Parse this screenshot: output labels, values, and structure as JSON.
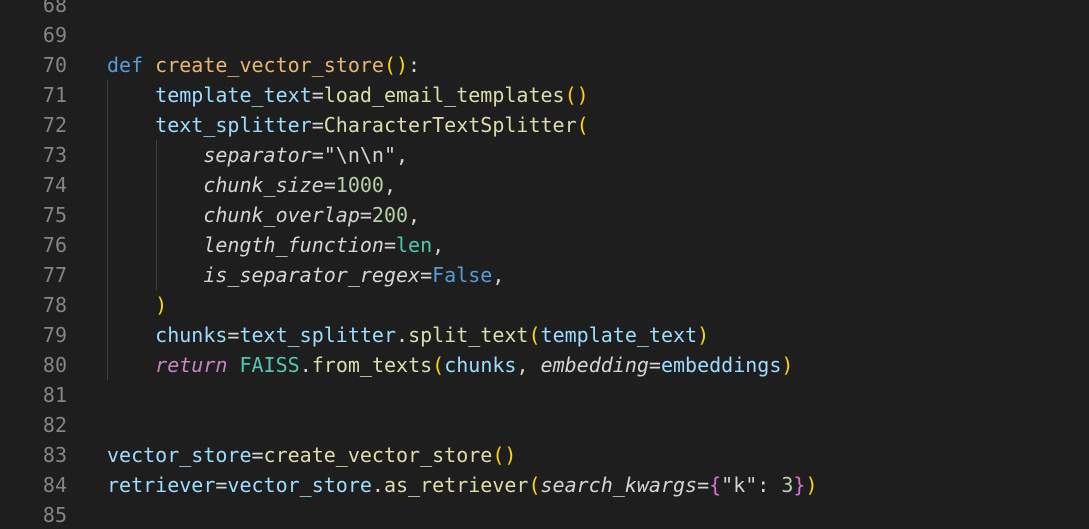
{
  "editor": {
    "language": "python",
    "colors": {
      "background": "#1e1e1e",
      "line_number": "#858585",
      "keyword": "#569cd6",
      "function": "#dcdcaa",
      "variable": "#9cdcfe",
      "string": "#ce9178",
      "number": "#b5cea8",
      "class": "#4ec9b0",
      "bracket": "#ffd700"
    },
    "lines": [
      {
        "num": "68",
        "tokens": []
      },
      {
        "num": "69",
        "tokens": []
      },
      {
        "num": "70",
        "tokens": [
          {
            "t": "def",
            "c": "kw-def"
          },
          {
            "t": " "
          },
          {
            "t": "create_vector_store",
            "c": "fn-def"
          },
          {
            "t": "(",
            "c": "p1"
          },
          {
            "t": ")",
            "c": "p1"
          },
          {
            "t": ":",
            "c": "punc"
          }
        ]
      },
      {
        "num": "71",
        "tokens": [
          {
            "t": "    "
          },
          {
            "t": "template_text",
            "c": "var"
          },
          {
            "t": "=",
            "c": "op"
          },
          {
            "t": "load_email_templates",
            "c": "fn"
          },
          {
            "t": "(",
            "c": "p1"
          },
          {
            "t": ")",
            "c": "p1"
          }
        ]
      },
      {
        "num": "72",
        "tokens": [
          {
            "t": "    "
          },
          {
            "t": "text_splitter",
            "c": "var"
          },
          {
            "t": "=",
            "c": "op"
          },
          {
            "t": "CharacterTextSplitter",
            "c": "fn"
          },
          {
            "t": "(",
            "c": "p1"
          }
        ]
      },
      {
        "num": "73",
        "tokens": [
          {
            "t": "        "
          },
          {
            "t": "separator",
            "c": "param"
          },
          {
            "t": "=",
            "c": "op"
          },
          {
            "t": "\"\\n\\n\"",
            "c": "op"
          },
          {
            "t": ",",
            "c": "punc"
          }
        ]
      },
      {
        "num": "74",
        "tokens": [
          {
            "t": "        "
          },
          {
            "t": "chunk_size",
            "c": "param"
          },
          {
            "t": "=",
            "c": "op"
          },
          {
            "t": "1000",
            "c": "num"
          },
          {
            "t": ",",
            "c": "punc"
          }
        ]
      },
      {
        "num": "75",
        "tokens": [
          {
            "t": "        "
          },
          {
            "t": "chunk_overlap",
            "c": "param"
          },
          {
            "t": "=",
            "c": "op"
          },
          {
            "t": "200",
            "c": "num"
          },
          {
            "t": ",",
            "c": "punc"
          }
        ]
      },
      {
        "num": "76",
        "tokens": [
          {
            "t": "        "
          },
          {
            "t": "length_function",
            "c": "param"
          },
          {
            "t": "=",
            "c": "op"
          },
          {
            "t": "len",
            "c": "builtin"
          },
          {
            "t": ",",
            "c": "punc"
          }
        ]
      },
      {
        "num": "77",
        "tokens": [
          {
            "t": "        "
          },
          {
            "t": "is_separator_regex",
            "c": "param"
          },
          {
            "t": "=",
            "c": "op"
          },
          {
            "t": "False",
            "c": "const"
          },
          {
            "t": ",",
            "c": "punc"
          }
        ]
      },
      {
        "num": "78",
        "tokens": [
          {
            "t": "    "
          },
          {
            "t": ")",
            "c": "p1"
          }
        ]
      },
      {
        "num": "79",
        "tokens": [
          {
            "t": "    "
          },
          {
            "t": "chunks",
            "c": "var"
          },
          {
            "t": "=",
            "c": "op"
          },
          {
            "t": "text_splitter",
            "c": "var"
          },
          {
            "t": ".",
            "c": "punc"
          },
          {
            "t": "split_text",
            "c": "fn"
          },
          {
            "t": "(",
            "c": "p1"
          },
          {
            "t": "template_text",
            "c": "var"
          },
          {
            "t": ")",
            "c": "p1"
          }
        ]
      },
      {
        "num": "80",
        "tokens": [
          {
            "t": "    "
          },
          {
            "t": "return",
            "c": "kw-ctrl"
          },
          {
            "t": " "
          },
          {
            "t": "FAISS",
            "c": "cls"
          },
          {
            "t": ".",
            "c": "punc"
          },
          {
            "t": "from_texts",
            "c": "fn"
          },
          {
            "t": "(",
            "c": "p1"
          },
          {
            "t": "chunks",
            "c": "var"
          },
          {
            "t": ", ",
            "c": "punc"
          },
          {
            "t": "embedding",
            "c": "param"
          },
          {
            "t": "=",
            "c": "op"
          },
          {
            "t": "embeddings",
            "c": "var"
          },
          {
            "t": ")",
            "c": "p1"
          }
        ]
      },
      {
        "num": "81",
        "tokens": []
      },
      {
        "num": "82",
        "tokens": []
      },
      {
        "num": "83",
        "tokens": [
          {
            "t": "vector_store",
            "c": "var"
          },
          {
            "t": "=",
            "c": "op"
          },
          {
            "t": "create_vector_store",
            "c": "fn"
          },
          {
            "t": "(",
            "c": "p1"
          },
          {
            "t": ")",
            "c": "p1"
          }
        ]
      },
      {
        "num": "84",
        "tokens": [
          {
            "t": "retriever",
            "c": "var"
          },
          {
            "t": "=",
            "c": "op"
          },
          {
            "t": "vector_store",
            "c": "var"
          },
          {
            "t": ".",
            "c": "punc"
          },
          {
            "t": "as_retriever",
            "c": "fn"
          },
          {
            "t": "(",
            "c": "p1"
          },
          {
            "t": "search_kwargs",
            "c": "param"
          },
          {
            "t": "=",
            "c": "op"
          },
          {
            "t": "{",
            "c": "p2"
          },
          {
            "t": "\"k\"",
            "c": "op"
          },
          {
            "t": ": ",
            "c": "punc"
          },
          {
            "t": "3",
            "c": "num"
          },
          {
            "t": "}",
            "c": "p2"
          },
          {
            "t": ")",
            "c": "p1"
          }
        ]
      },
      {
        "num": "85",
        "tokens": []
      }
    ]
  }
}
